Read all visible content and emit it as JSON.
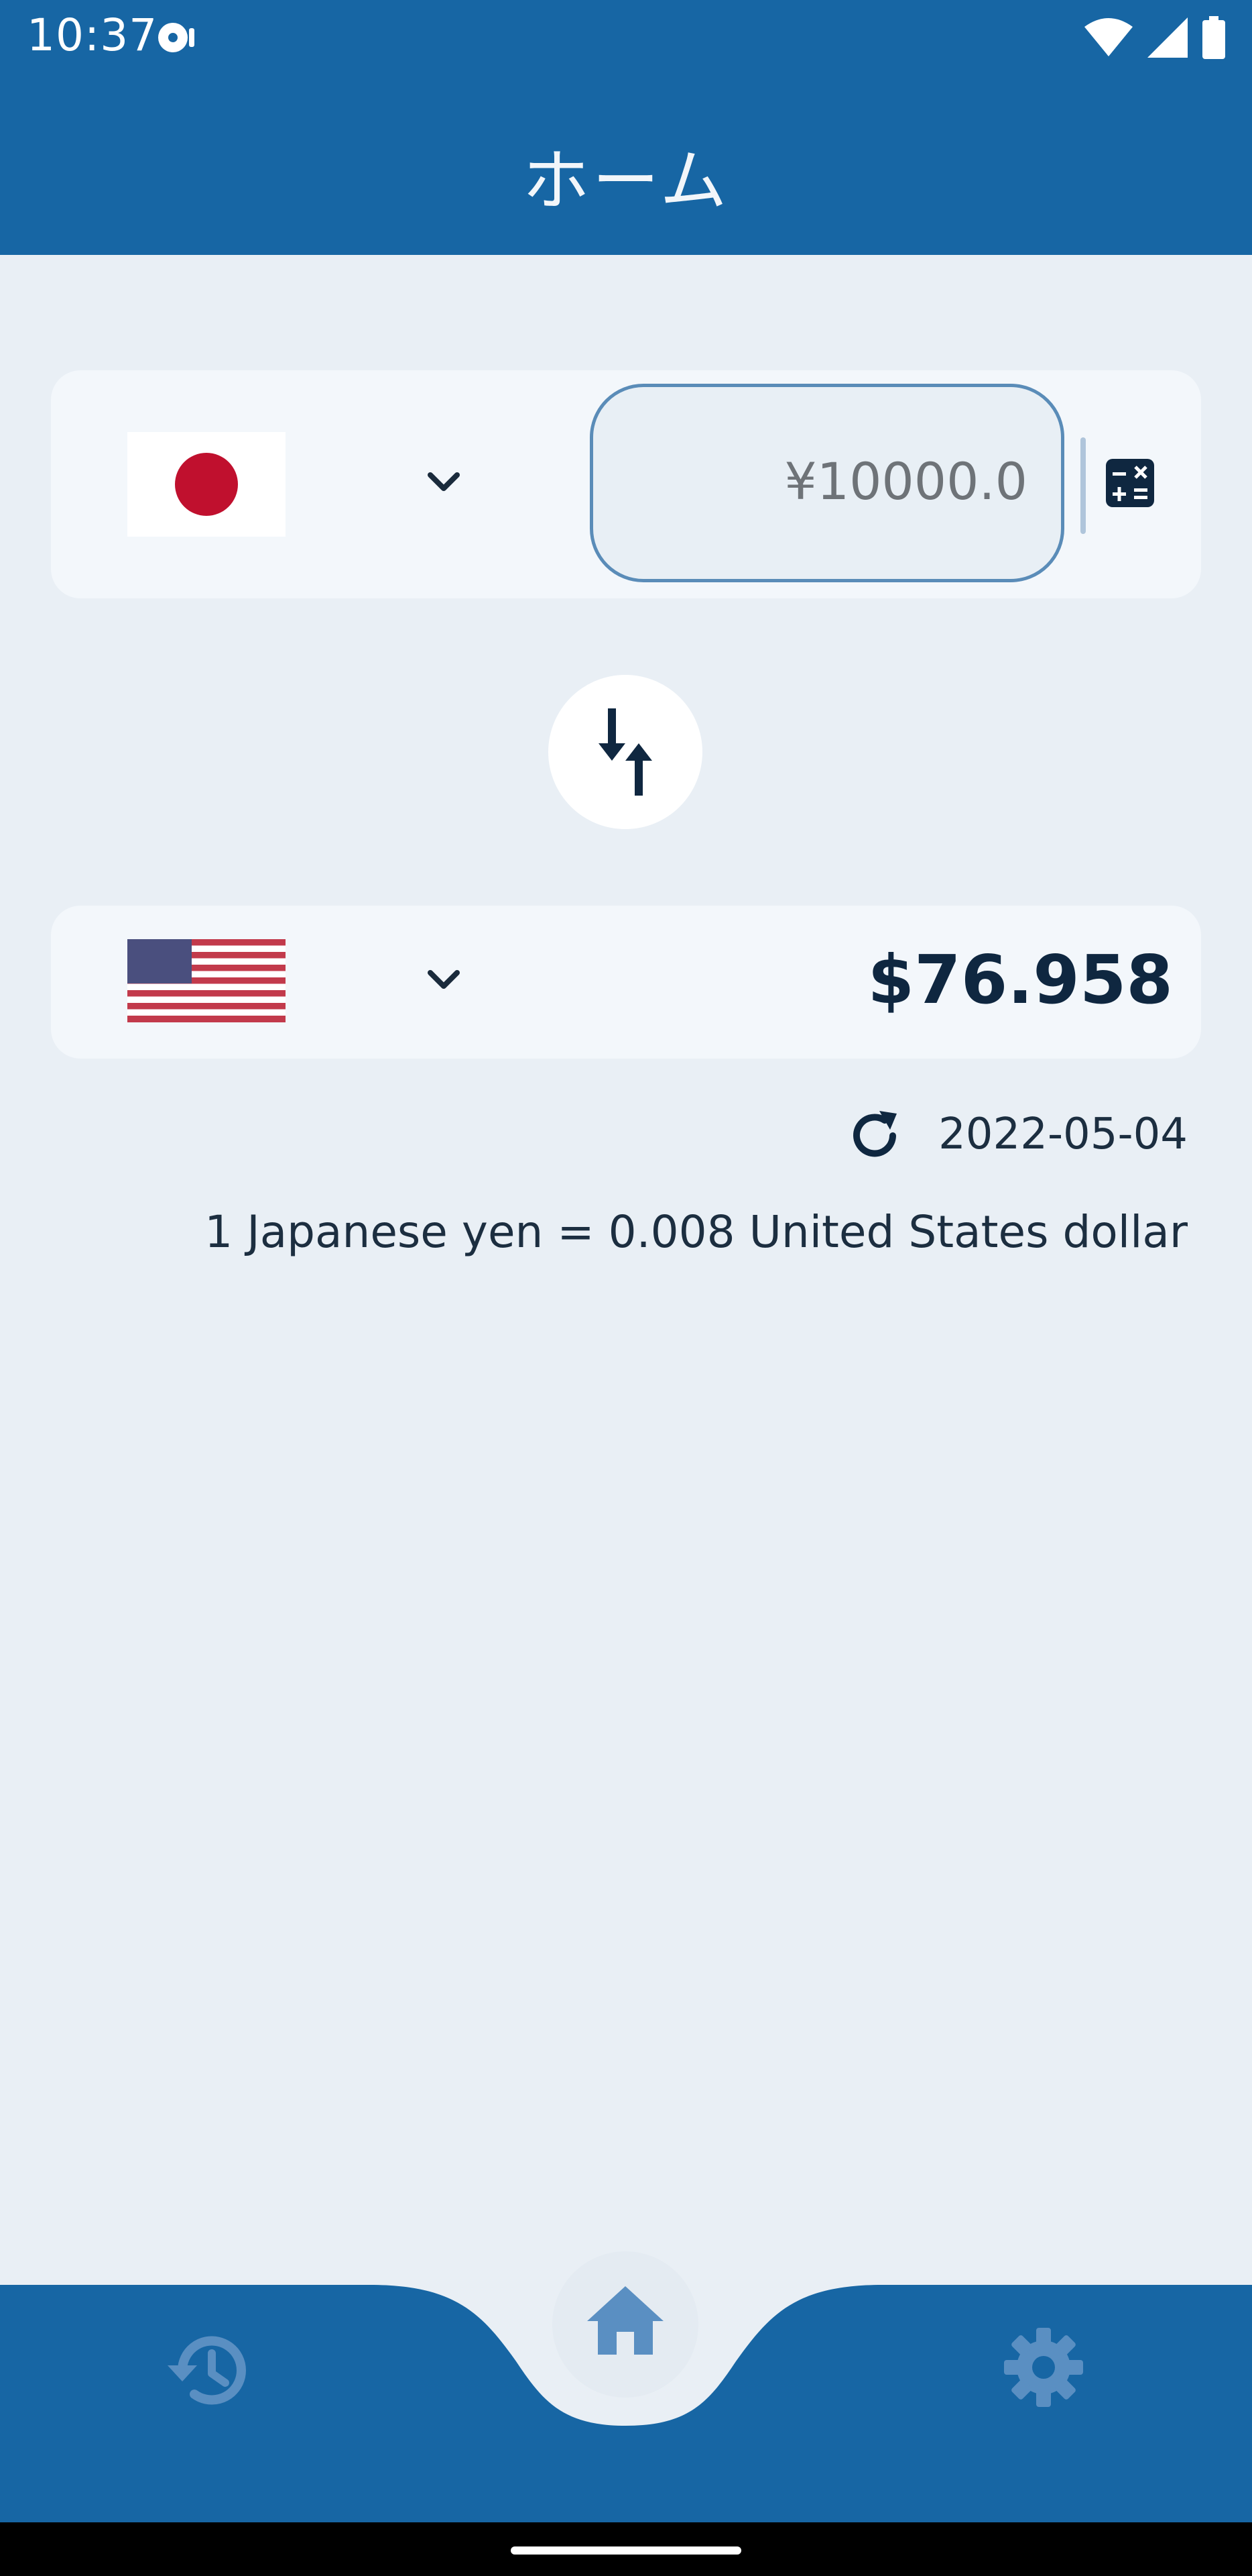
{
  "status_bar": {
    "time": "10:37",
    "icons": [
      "media-icon",
      "wifi-icon",
      "signal-icon",
      "battery-icon"
    ]
  },
  "app_bar": {
    "title": "ホーム"
  },
  "converter": {
    "from": {
      "currency_flag": "flag-japan",
      "amount_placeholder": "¥10000.0"
    },
    "to": {
      "currency_flag": "flag-united-states",
      "converted_amount": "$76.958"
    },
    "swap_icon": "swap-vertical-icon"
  },
  "rate_info": {
    "date": "2022-05-04",
    "rate_text": "1 Japanese yen = 0.008 United States dollar"
  },
  "bottom_nav": {
    "items": [
      "history-icon",
      "home-icon",
      "settings-icon"
    ],
    "active": "home"
  },
  "colors": {
    "primary": "#1766A4",
    "background": "#E9EFF5",
    "card": "#F3F7FB",
    "text_dark": "#0F2740",
    "nav_icon": "#5A8FC2"
  }
}
